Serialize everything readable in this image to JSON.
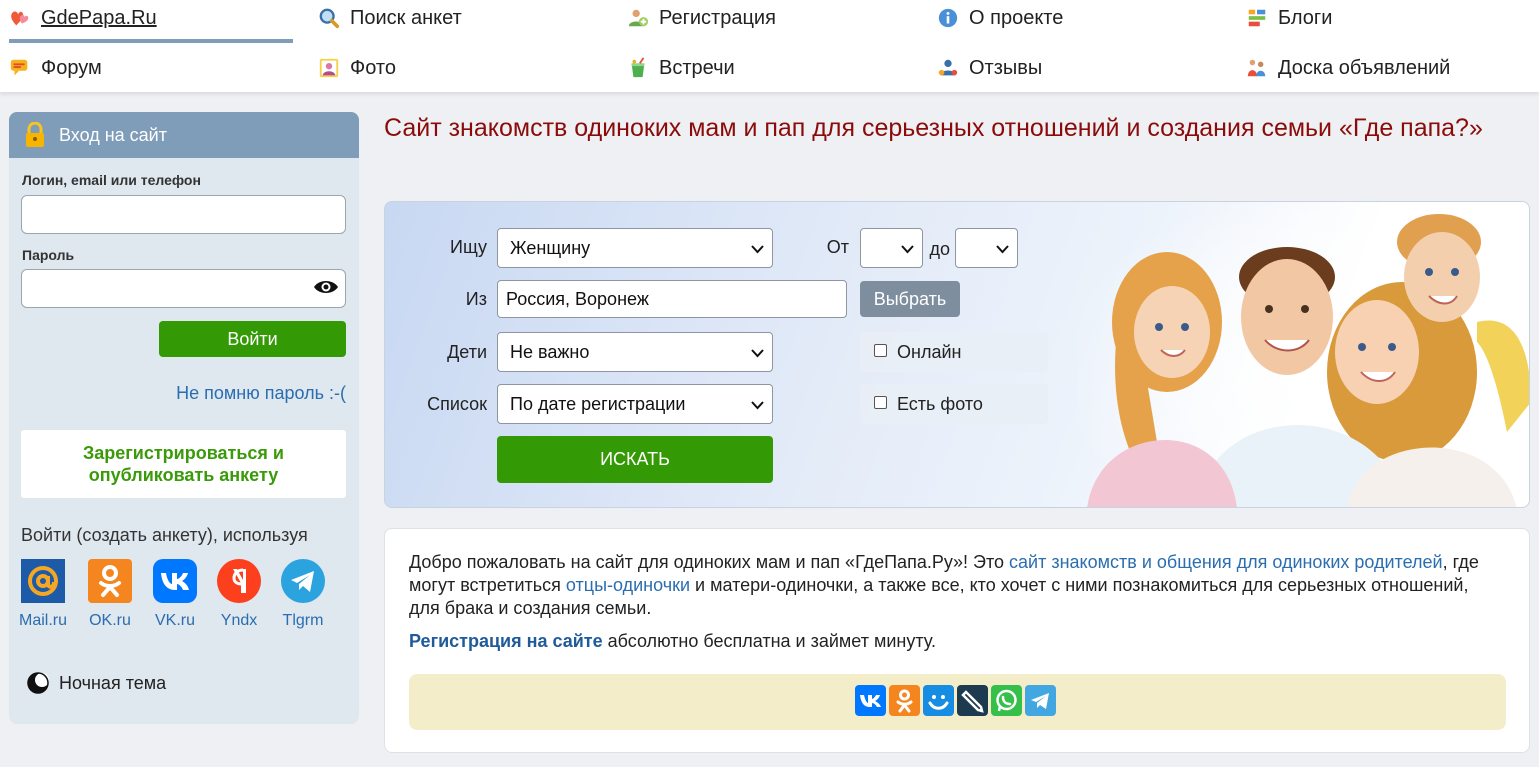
{
  "nav": {
    "row1": [
      {
        "label": "GdePapa.Ru",
        "icon": "hearts-icon"
      },
      {
        "label": "Поиск анкет",
        "icon": "magnifier-icon"
      },
      {
        "label": "Регистрация",
        "icon": "add-user-icon"
      },
      {
        "label": "О проекте",
        "icon": "info-icon"
      },
      {
        "label": "Блоги",
        "icon": "blog-icon"
      }
    ],
    "row2": [
      {
        "label": "Форум",
        "icon": "forum-icon"
      },
      {
        "label": "Фото",
        "icon": "photo-icon"
      },
      {
        "label": "Встречи",
        "icon": "drink-icon"
      },
      {
        "label": "Отзывы",
        "icon": "reviews-icon"
      },
      {
        "label": "Доска объявлений",
        "icon": "board-icon"
      }
    ]
  },
  "login": {
    "title": "Вход на сайт",
    "login_label": "Логин, email или телефон",
    "login_value": "",
    "password_label": "Пароль",
    "password_value": "",
    "submit_label": "Войти",
    "forgot_label": "Не помню пароль :-(",
    "register_label": "Зарегистрироваться и опубликовать анкету",
    "social_title": "Войти (создать анкету), используя",
    "social": [
      {
        "caption": "Mail.ru",
        "icon": "mailru-icon",
        "color": "#1d5aa7"
      },
      {
        "caption": "OK.ru",
        "icon": "odnoklassniki-icon",
        "color": "#f5861f"
      },
      {
        "caption": "VK.ru",
        "icon": "vk-icon",
        "color": "#0077ff"
      },
      {
        "caption": "Yndx",
        "icon": "yandex-icon",
        "color": "#fc3f1d"
      },
      {
        "caption": "Tlgrm",
        "icon": "telegram-icon",
        "color": "#2aa3df"
      }
    ],
    "night_mode_label": "Ночная тема"
  },
  "page_title": "Сайт знакомств одиноких мам и пап для серьезных отношений и создания семьи «Где папа?»",
  "search": {
    "seek_label": "Ищу",
    "seek_value": "Женщину",
    "from_label": "От",
    "from_value": "",
    "to_label": "до",
    "to_value": "",
    "location_label": "Из",
    "location_value": "Россия, Воронеж",
    "choose_label": "Выбрать",
    "children_label": "Дети",
    "children_value": "Не важно",
    "list_label": "Список",
    "list_value": "По дате регистрации",
    "online_label": "Онлайн",
    "online_checked": false,
    "photo_label": "Есть фото",
    "photo_checked": false,
    "submit_label": "ИСКАТЬ"
  },
  "welcome": {
    "p1_a": "Добро пожаловать на сайт для одиноких мам и пап «ГдеПапа.Ру»! Это ",
    "p1_link1": "сайт знакомств и общения для одиноких родителей",
    "p1_b": ", где могут встретиться ",
    "p1_link2": "отцы-одиночки",
    "p1_c": " и матери-одиночки, а также все, кто хочет с ними познакомиться для серьезных отношений, для брака и создания семьи.",
    "p2_link": "Регистрация на сайте",
    "p2_text": " абсолютно бесплатна и займет минуту."
  },
  "share": [
    {
      "icon": "vk-share-icon",
      "color": "#0077ff"
    },
    {
      "icon": "ok-share-icon",
      "color": "#f5861f"
    },
    {
      "icon": "moimir-share-icon",
      "color": "#168de2"
    },
    {
      "icon": "livejournal-share-icon",
      "color": "#1d3a4e"
    },
    {
      "icon": "whatsapp-share-icon",
      "color": "#36c04b"
    },
    {
      "icon": "telegram-share-icon",
      "color": "#42a7e0"
    }
  ]
}
